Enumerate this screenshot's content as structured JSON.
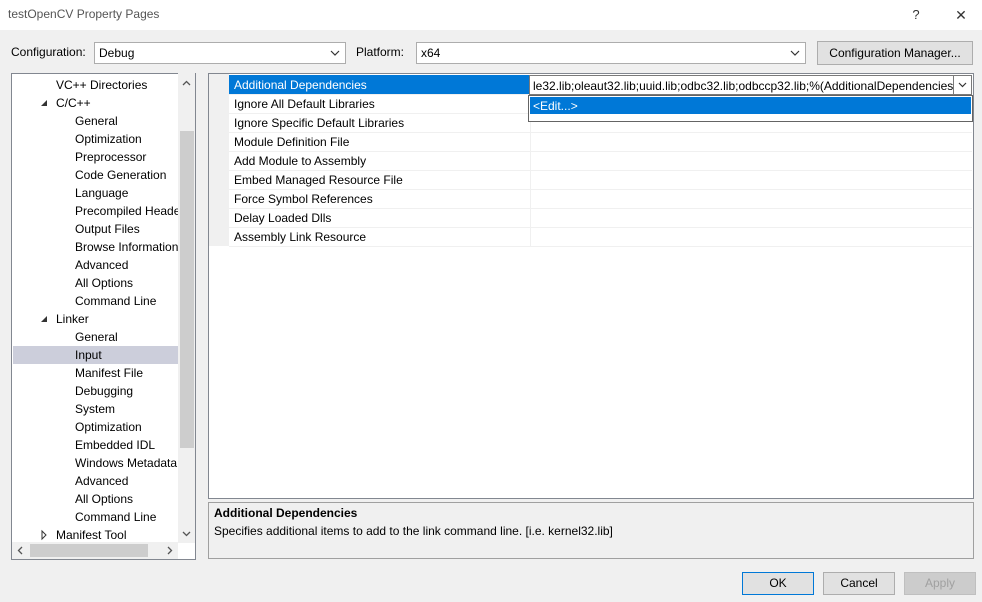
{
  "window": {
    "title": "testOpenCV Property Pages",
    "help_label": "?",
    "close_label": "✕"
  },
  "config": {
    "configuration_label": "Configuration:",
    "configuration_value": "Debug",
    "platform_label": "Platform:",
    "platform_value": "x64",
    "manager_button": "Configuration Manager..."
  },
  "tree": {
    "items": [
      {
        "label": "VC++ Directories",
        "level": 1,
        "expander": ""
      },
      {
        "label": "C/C++",
        "level": 1,
        "expander": "expanded"
      },
      {
        "label": "General",
        "level": 2,
        "expander": ""
      },
      {
        "label": "Optimization",
        "level": 2,
        "expander": ""
      },
      {
        "label": "Preprocessor",
        "level": 2,
        "expander": ""
      },
      {
        "label": "Code Generation",
        "level": 2,
        "expander": ""
      },
      {
        "label": "Language",
        "level": 2,
        "expander": ""
      },
      {
        "label": "Precompiled Heade",
        "level": 2,
        "expander": ""
      },
      {
        "label": "Output Files",
        "level": 2,
        "expander": ""
      },
      {
        "label": "Browse Information",
        "level": 2,
        "expander": ""
      },
      {
        "label": "Advanced",
        "level": 2,
        "expander": ""
      },
      {
        "label": "All Options",
        "level": 2,
        "expander": ""
      },
      {
        "label": "Command Line",
        "level": 2,
        "expander": ""
      },
      {
        "label": "Linker",
        "level": 1,
        "expander": "expanded"
      },
      {
        "label": "General",
        "level": 2,
        "expander": ""
      },
      {
        "label": "Input",
        "level": 2,
        "expander": "",
        "selected": true
      },
      {
        "label": "Manifest File",
        "level": 2,
        "expander": ""
      },
      {
        "label": "Debugging",
        "level": 2,
        "expander": ""
      },
      {
        "label": "System",
        "level": 2,
        "expander": ""
      },
      {
        "label": "Optimization",
        "level": 2,
        "expander": ""
      },
      {
        "label": "Embedded IDL",
        "level": 2,
        "expander": ""
      },
      {
        "label": "Windows Metadata",
        "level": 2,
        "expander": ""
      },
      {
        "label": "Advanced",
        "level": 2,
        "expander": ""
      },
      {
        "label": "All Options",
        "level": 2,
        "expander": ""
      },
      {
        "label": "Command Line",
        "level": 2,
        "expander": ""
      },
      {
        "label": "Manifest Tool",
        "level": 1,
        "expander": "collapsed"
      }
    ]
  },
  "grid": {
    "properties": [
      {
        "name": "Additional Dependencies",
        "selected": true
      },
      {
        "name": "Ignore All Default Libraries"
      },
      {
        "name": "Ignore Specific Default Libraries"
      },
      {
        "name": "Module Definition File"
      },
      {
        "name": "Add Module to Assembly"
      },
      {
        "name": "Embed Managed Resource File"
      },
      {
        "name": "Force Symbol References"
      },
      {
        "name": "Delay Loaded Dlls"
      },
      {
        "name": "Assembly Link Resource"
      }
    ],
    "selected_value": "le32.lib;oleaut32.lib;uuid.lib;odbc32.lib;odbccp32.lib;%(AdditionalDependencies)",
    "dropdown_item": "<Edit...>"
  },
  "description": {
    "title": "Additional Dependencies",
    "text": "Specifies additional items to add to the link command line. [i.e. kernel32.lib]"
  },
  "buttons": {
    "ok": "OK",
    "cancel": "Cancel",
    "apply": "Apply"
  }
}
